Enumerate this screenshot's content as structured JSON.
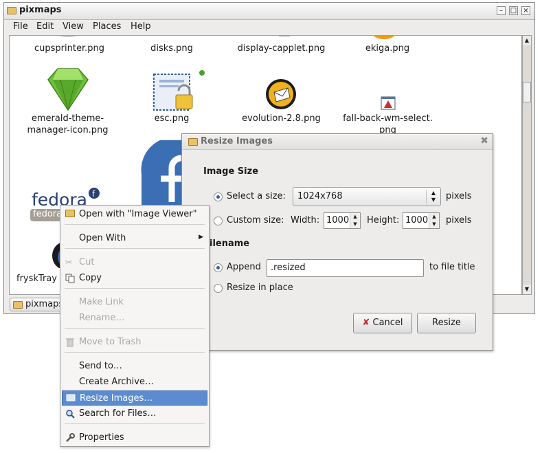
{
  "window": {
    "title": "pixmaps",
    "menus": [
      "File",
      "Edit",
      "View",
      "Places",
      "Help"
    ],
    "status_path": "pixmaps"
  },
  "files": [
    {
      "name": "cupsprinter.png"
    },
    {
      "name": "disks.png"
    },
    {
      "name": "display-capplet.png"
    },
    {
      "name": "ekiga.png"
    },
    {
      "name": "emerald-theme-manager-icon.png",
      "lines": [
        "emerald-theme-",
        "manager-icon.png"
      ]
    },
    {
      "name": "esc.png"
    },
    {
      "name": "evolution-2.8.png"
    },
    {
      "name": "fall-back-wm-select.png",
      "lines": [
        "fall-back-wm-select.",
        "png"
      ]
    },
    {
      "name": "fedora",
      "logo_text": "fedora"
    },
    {
      "name": "fryskTray"
    }
  ],
  "dialog": {
    "title": "Resize Images",
    "image_size_heading": "Image Size",
    "select_size_label": "Select a size:",
    "select_size_value": "1024x768",
    "pixels_label": "pixels",
    "custom_size_label": "Custom size:",
    "width_label": "Width:",
    "width_value": "1000",
    "height_label": "Height:",
    "height_value": "1000",
    "filename_heading": "ilename",
    "append_label": "Append",
    "append_value": ".resized",
    "to_file_title_label": "to file title",
    "resize_in_place_label": "Resize in place",
    "cancel_label": "Cancel",
    "resize_label": "Resize"
  },
  "context_menu": {
    "open_with_viewer": "Open with \"Image Viewer\"",
    "open_with": "Open With",
    "cut": "Cut",
    "copy": "Copy",
    "make_link": "Make Link",
    "rename": "Rename…",
    "move_to_trash": "Move to Trash",
    "send_to": "Send to…",
    "create_archive": "Create Archive…",
    "resize_images": "Resize Images…",
    "search_for_files": "Search for Files…",
    "properties": "Properties"
  },
  "colors": {
    "selection": "#5b8cd0",
    "emerald": "#6cc13a",
    "fedora_blue": "#294172"
  }
}
